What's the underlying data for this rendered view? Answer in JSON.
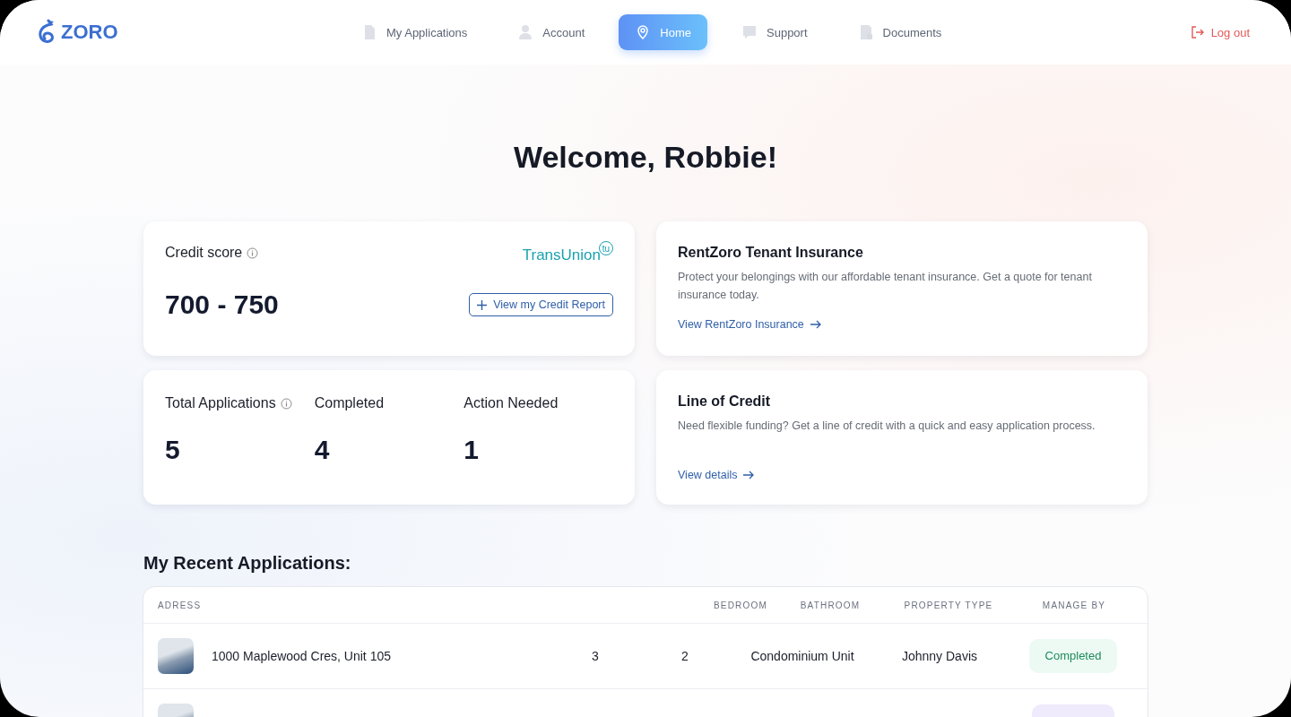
{
  "brand": {
    "name": "ZORO"
  },
  "nav": [
    {
      "label": "My Applications",
      "kind": "document",
      "selected": false
    },
    {
      "label": "Account",
      "kind": "person",
      "selected": false
    },
    {
      "label": "Home",
      "kind": "pin",
      "selected": true
    },
    {
      "label": "Support",
      "kind": "help",
      "selected": false
    },
    {
      "label": "Documents",
      "kind": "files",
      "selected": false
    }
  ],
  "logout": {
    "label": "Log out"
  },
  "greeting": "Welcome, Robbie!",
  "credit": {
    "title": "Credit score",
    "score": "700 - 750",
    "button": "View my Credit Report",
    "bureau": {
      "name": "TransUnion",
      "badge": "tu"
    }
  },
  "stats": [
    {
      "label": "Total Applications",
      "value": "5",
      "info": true
    },
    {
      "label": "Completed",
      "value": "4",
      "info": false
    },
    {
      "label": "Action Needed",
      "value": "1",
      "info": false
    }
  ],
  "offers": [
    {
      "title": "RentZoro Tenant Insurance",
      "text": "Protect your belongings with our affordable tenant insurance. Get a quote for tenant insurance today.",
      "link": "View RentZoro Insurance"
    },
    {
      "title": "Line of Credit",
      "text": "Need flexible funding? Get a line of credit with a quick and easy application process.",
      "link": "View details"
    }
  ],
  "recent": {
    "title": "My Recent Applications:",
    "columns": [
      "ADRESS",
      "BEDROOM",
      "BATHROOM",
      "PROPERTY TYPE",
      "MANAGE BY"
    ],
    "rows": [
      {
        "address": "1000 Maplewood Cres, Unit 105",
        "bedroom": "3",
        "bathroom": "2",
        "property_type": "Condominium Unit",
        "manager": "Johnny Davis",
        "status": "Completed",
        "kind": "completed"
      },
      {
        "kind": "pending"
      }
    ]
  }
}
